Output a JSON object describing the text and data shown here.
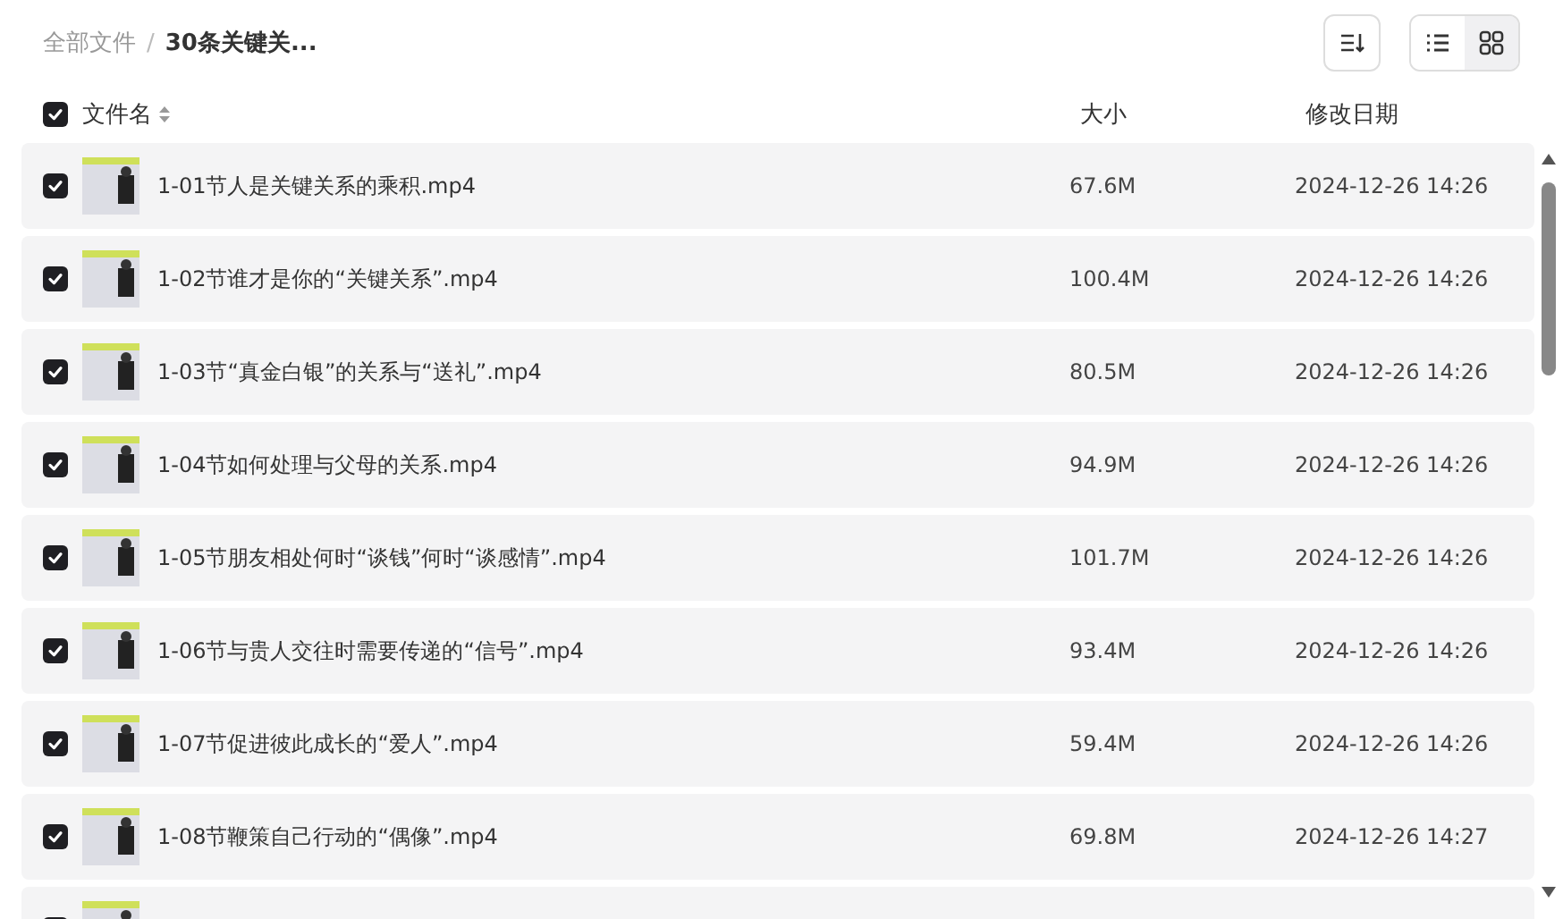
{
  "breadcrumb": [
    {
      "label": "全部文件",
      "current": false
    },
    {
      "separator": "/",
      "label": "30条关键关...",
      "current": true
    }
  ],
  "toolbar": {
    "view_modes": [
      {
        "kind": "list",
        "selected": false
      },
      {
        "kind": "grid",
        "selected": true
      }
    ]
  },
  "table": {
    "select_all": {
      "checked": true
    },
    "columns": [
      {
        "label": "文件名",
        "sortable": true
      },
      {
        "label": "大小",
        "sortable": false
      },
      {
        "label": "修改日期",
        "sortable": false
      }
    ],
    "rows": [
      {
        "checked": true,
        "name": "1-01节人是关键关系的乘积.mp4",
        "size": "67.6M",
        "modified": "2024-12-26 14:26"
      },
      {
        "checked": true,
        "name": "1-02节谁才是你的“关键关系”.mp4",
        "size": "100.4M",
        "modified": "2024-12-26 14:26"
      },
      {
        "checked": true,
        "name": "1-03节“真金白银”的关系与“送礼”.mp4",
        "size": "80.5M",
        "modified": "2024-12-26 14:26"
      },
      {
        "checked": true,
        "name": "1-04节如何处理与父母的关系.mp4",
        "size": "94.9M",
        "modified": "2024-12-26 14:26"
      },
      {
        "checked": true,
        "name": "1-05节朋友相处何时“谈钱”何时“谈感情”.mp4",
        "size": "101.7M",
        "modified": "2024-12-26 14:26"
      },
      {
        "checked": true,
        "name": "1-06节与贵人交往时需要传递的“信号”.mp4",
        "size": "93.4M",
        "modified": "2024-12-26 14:26"
      },
      {
        "checked": true,
        "name": "1-07节促进彼此成长的“爱人”.mp4",
        "size": "59.4M",
        "modified": "2024-12-26 14:26"
      },
      {
        "checked": true,
        "name": "1-08节鞭策自己行动的“偶像”.mp4",
        "size": "69.8M",
        "modified": "2024-12-26 14:27"
      },
      {
        "checked": true
      }
    ]
  }
}
